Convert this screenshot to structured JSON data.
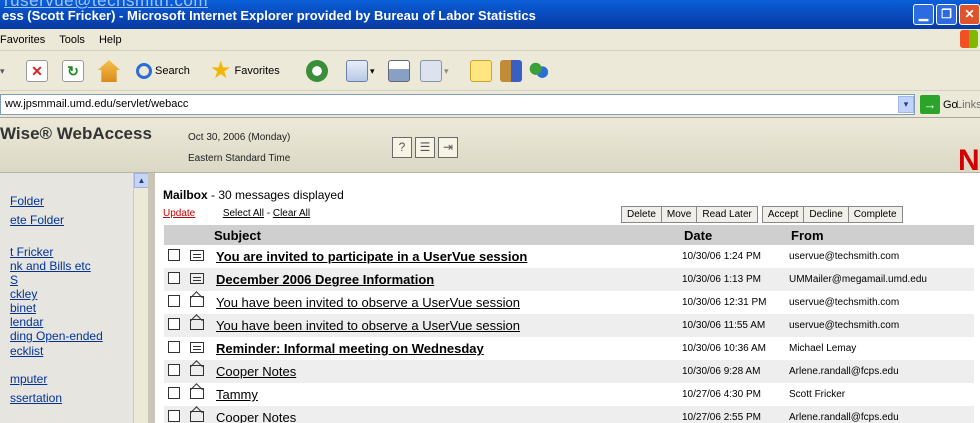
{
  "window": {
    "email_fragment": "ruservue@techsmith.com",
    "title": "ess (Scott Fricker) - Microsoft Internet Explorer provided by Bureau of Labor Statistics",
    "min": "▁",
    "max": "❐",
    "close": "✕"
  },
  "menu": [
    "Favorites",
    "Tools",
    "Help"
  ],
  "toolbar": {
    "search": "Search",
    "favorites": "Favorites"
  },
  "address": {
    "url": "ww.jpsmmail.umd.edu/servlet/webacc",
    "go": "Go",
    "links": "Links",
    "dropdown": "▾",
    "go_arrow": "→"
  },
  "header": {
    "brand": "Wise® WebAccess",
    "date": "Oct 30, 2006 (Monday)",
    "timezone": "Eastern Standard Time",
    "logo_letter": "N"
  },
  "sidebar": {
    "scroll_up": "▲",
    "items": [
      "Folder",
      "ete Folder",
      "t Fricker",
      "nk and Bills etc",
      "S",
      "ckley",
      "binet",
      "lendar",
      "ding Open-ended",
      "ecklist",
      "mputer",
      "ssertation"
    ]
  },
  "mailbox": {
    "title_bold": "Mailbox",
    "title_rest": " - 30 messages displayed",
    "update": "Update",
    "select_all": "Select All",
    "sep": " - ",
    "clear_all": "Clear All",
    "action_group1": [
      "Delete",
      "Move",
      "Read Later"
    ],
    "action_group2": [
      "Accept",
      "Decline",
      "Complete"
    ],
    "columns": {
      "subject": "Subject",
      "date": "Date",
      "from": "From"
    },
    "messages": [
      {
        "subject": "You are invited to participate in a UserVue session",
        "date": "10/30/06 1:24 PM",
        "from": "uservue@techsmith.com",
        "unread": true
      },
      {
        "subject": "December 2006 Degree Information",
        "date": "10/30/06 1:13 PM",
        "from": "UMMailer@megamail.umd.edu",
        "unread": true
      },
      {
        "subject": "You have been invited to observe a UserVue session",
        "date": "10/30/06 12:31 PM",
        "from": "uservue@techsmith.com",
        "unread": false
      },
      {
        "subject": "You have been invited to observe a UserVue session",
        "date": "10/30/06 11:55 AM",
        "from": "uservue@techsmith.com",
        "unread": false
      },
      {
        "subject": "Reminder: Informal meeting on Wednesday",
        "date": "10/30/06 10:36 AM",
        "from": "Michael Lemay",
        "unread": true
      },
      {
        "subject": "Cooper Notes",
        "date": "10/30/06 9:28 AM",
        "from": "Arlene.randall@fcps.edu",
        "unread": false
      },
      {
        "subject": "Tammy",
        "date": "10/27/06 4:30 PM",
        "from": "Scott Fricker",
        "unread": false
      },
      {
        "subject": "Cooper Notes",
        "date": "10/27/06 2:55 PM",
        "from": "Arlene.randall@fcps.edu",
        "unread": false
      }
    ]
  }
}
